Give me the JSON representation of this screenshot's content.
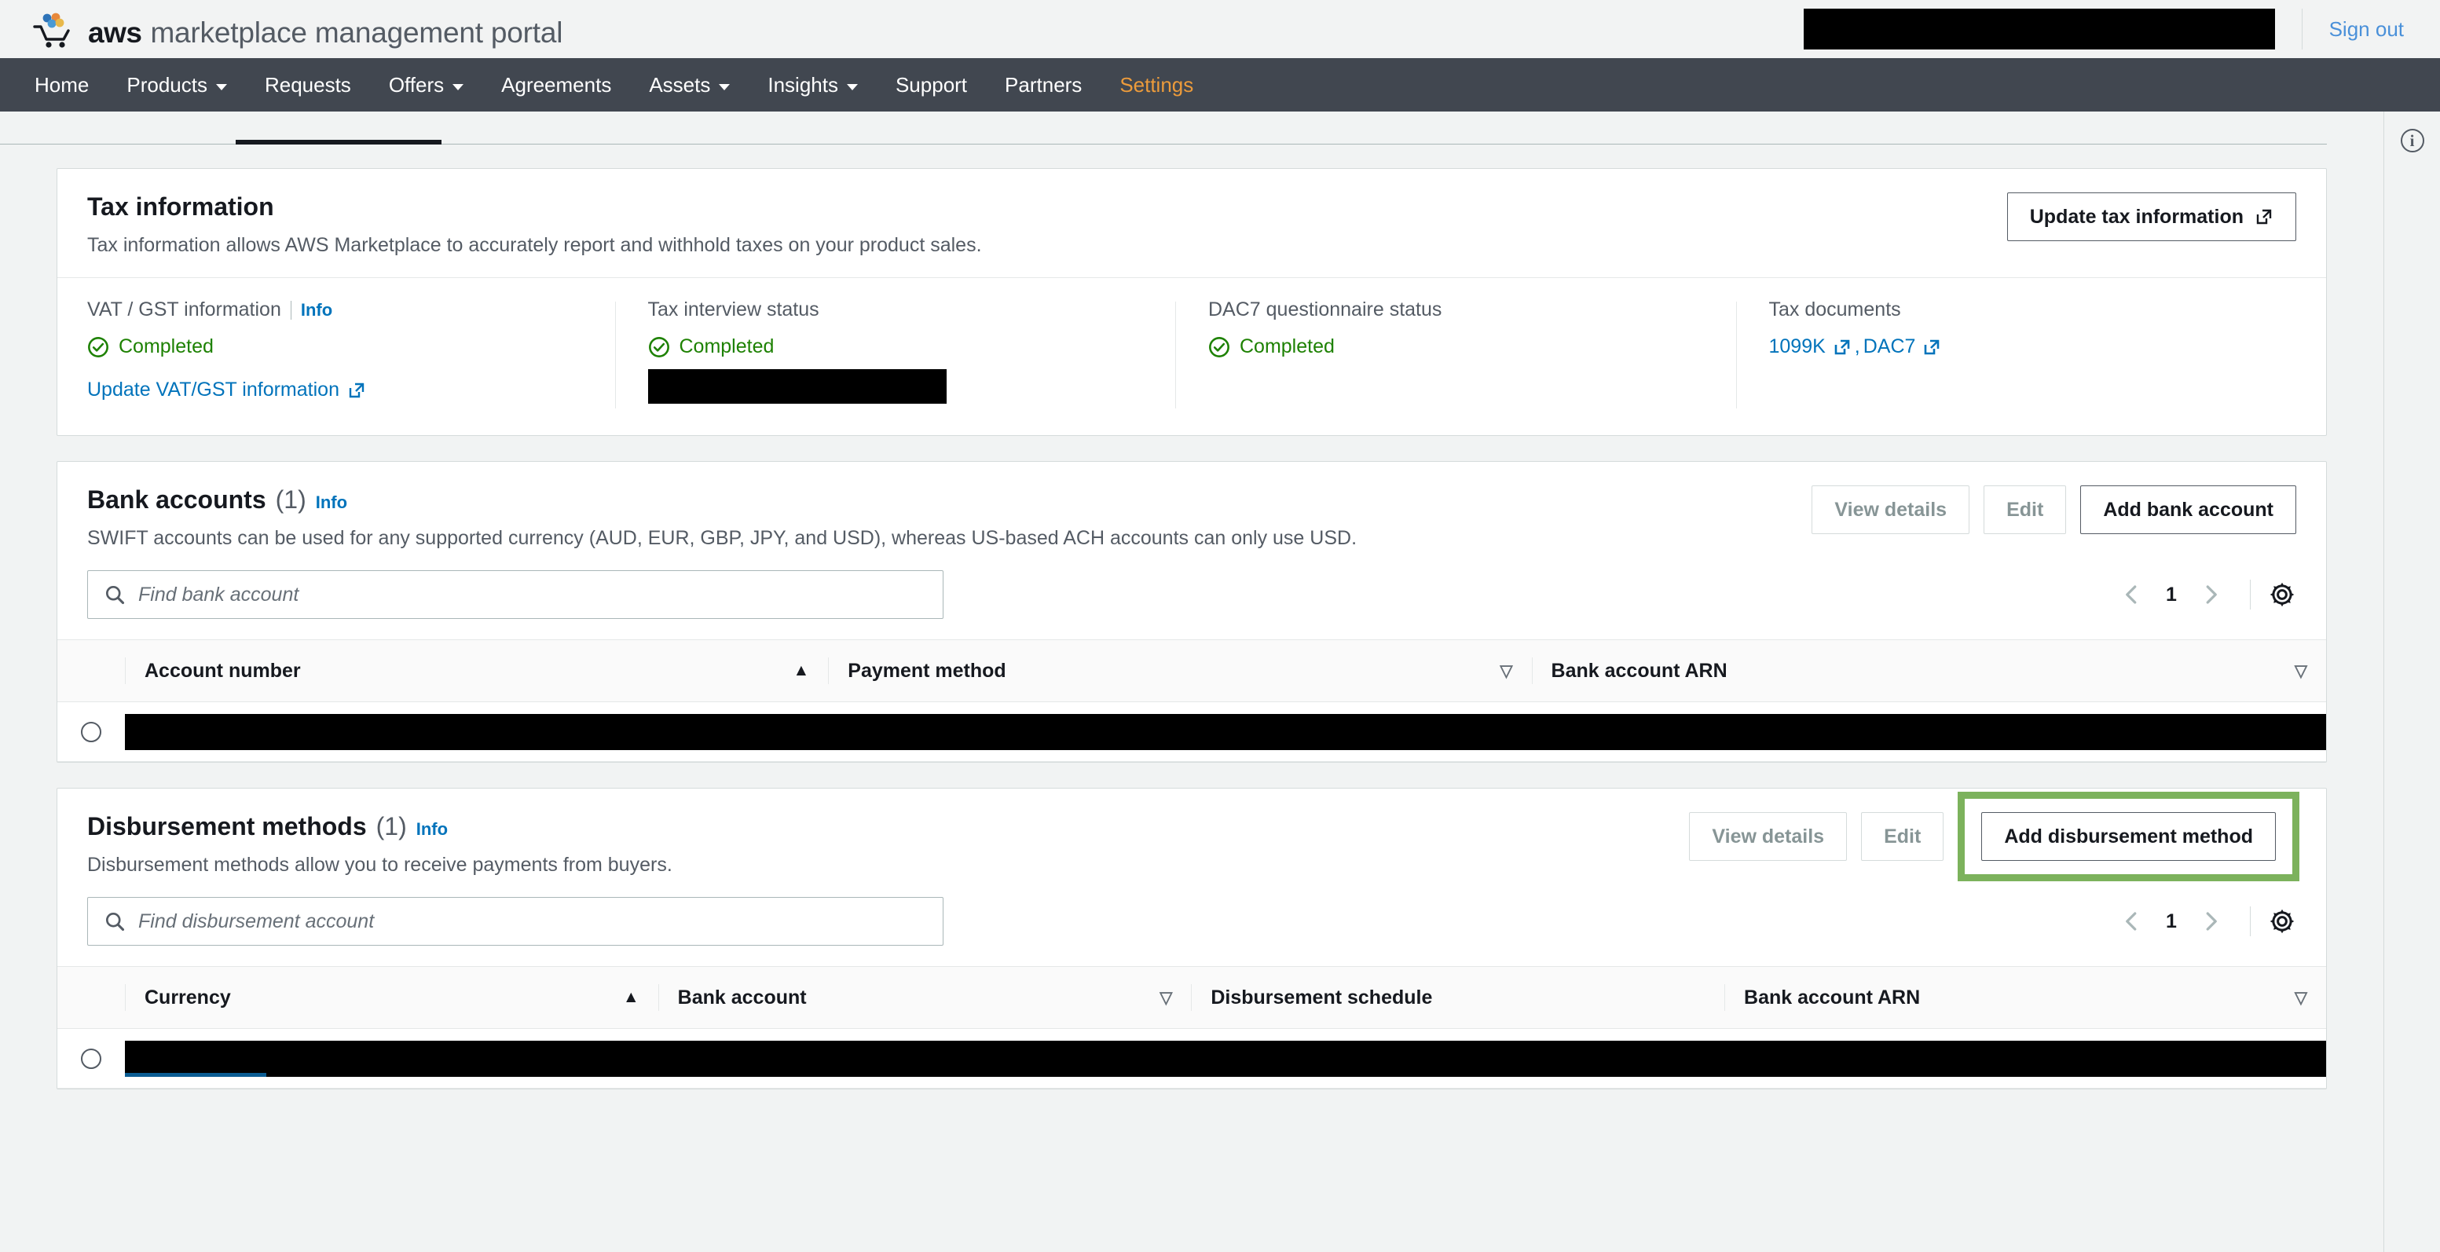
{
  "header": {
    "brand_aws": "aws",
    "brand_rest": "marketplace management portal",
    "logo_icon": "aws-marketplace-cart-icon",
    "account_redacted": "",
    "signout_label": "Sign out"
  },
  "nav": {
    "items": [
      {
        "label": "Home",
        "has_caret": false,
        "active": false
      },
      {
        "label": "Products",
        "has_caret": true,
        "active": false
      },
      {
        "label": "Requests",
        "has_caret": false,
        "active": false
      },
      {
        "label": "Offers",
        "has_caret": true,
        "active": false
      },
      {
        "label": "Agreements",
        "has_caret": false,
        "active": false
      },
      {
        "label": "Assets",
        "has_caret": true,
        "active": false
      },
      {
        "label": "Insights",
        "has_caret": true,
        "active": false
      },
      {
        "label": "Support",
        "has_caret": false,
        "active": false
      },
      {
        "label": "Partners",
        "has_caret": false,
        "active": false
      },
      {
        "label": "Settings",
        "has_caret": false,
        "active": true
      }
    ],
    "active_color": "#ec9b3b",
    "bg_color": "#414750"
  },
  "right_rail": {
    "info_icon": "info-circle-icon",
    "info_glyph": "i"
  },
  "tax_card": {
    "title": "Tax information",
    "description": "Tax information allows AWS Marketplace to accurately report and withhold taxes on your product sales.",
    "update_button": "Update tax information",
    "columns": [
      {
        "label": "VAT / GST information",
        "has_info": true,
        "info_label": "Info",
        "status": "Completed",
        "link": "Update VAT/GST information",
        "redacted": false
      },
      {
        "label": "Tax interview status",
        "has_info": false,
        "status": "Completed",
        "redacted": true
      },
      {
        "label": "DAC7 questionnaire status",
        "has_info": false,
        "status": "Completed",
        "redacted": false
      },
      {
        "label": "Tax documents",
        "has_info": false,
        "documents": [
          "1099K",
          "DAC7"
        ]
      }
    ]
  },
  "bank_card": {
    "title": "Bank accounts",
    "count": "(1)",
    "info_label": "Info",
    "description": "SWIFT accounts can be used for any supported currency (AUD, EUR, GBP, JPY, and USD), whereas US-based ACH accounts can only use USD.",
    "actions": [
      {
        "label": "View details",
        "disabled": true
      },
      {
        "label": "Edit",
        "disabled": true
      },
      {
        "label": "Add bank account",
        "disabled": false
      }
    ],
    "search_placeholder": "Find bank account",
    "page_number": "1",
    "columns": [
      {
        "label": "Account number",
        "sort": "asc"
      },
      {
        "label": "Payment method",
        "sort": "desc"
      },
      {
        "label": "Bank account ARN",
        "sort": "desc"
      }
    ],
    "rows": [
      {
        "redacted": true
      }
    ]
  },
  "disbursement_card": {
    "title": "Disbursement methods",
    "count": "(1)",
    "info_label": "Info",
    "description": "Disbursement methods allow you to receive payments from buyers.",
    "actions": [
      {
        "label": "View details",
        "disabled": true
      },
      {
        "label": "Edit",
        "disabled": true
      },
      {
        "label": "Add disbursement method",
        "disabled": false,
        "highlighted": true
      }
    ],
    "highlight_color": "#7cb25c",
    "search_placeholder": "Find disbursement account",
    "page_number": "1",
    "columns": [
      {
        "label": "Currency",
        "sort": "asc"
      },
      {
        "label": "Bank account",
        "sort": "desc"
      },
      {
        "label": "Disbursement schedule",
        "sort": "none"
      },
      {
        "label": "Bank account ARN",
        "sort": "desc"
      }
    ],
    "rows": [
      {
        "redacted": true
      }
    ]
  },
  "icons": {
    "search": "search-icon",
    "gear": "gear-icon",
    "external": "external-link-icon",
    "check": "check-circle-icon",
    "chevron_left": "chevron-left-icon",
    "chevron_right": "chevron-right-icon",
    "sort_asc": "▲",
    "sort_desc": "▽"
  }
}
